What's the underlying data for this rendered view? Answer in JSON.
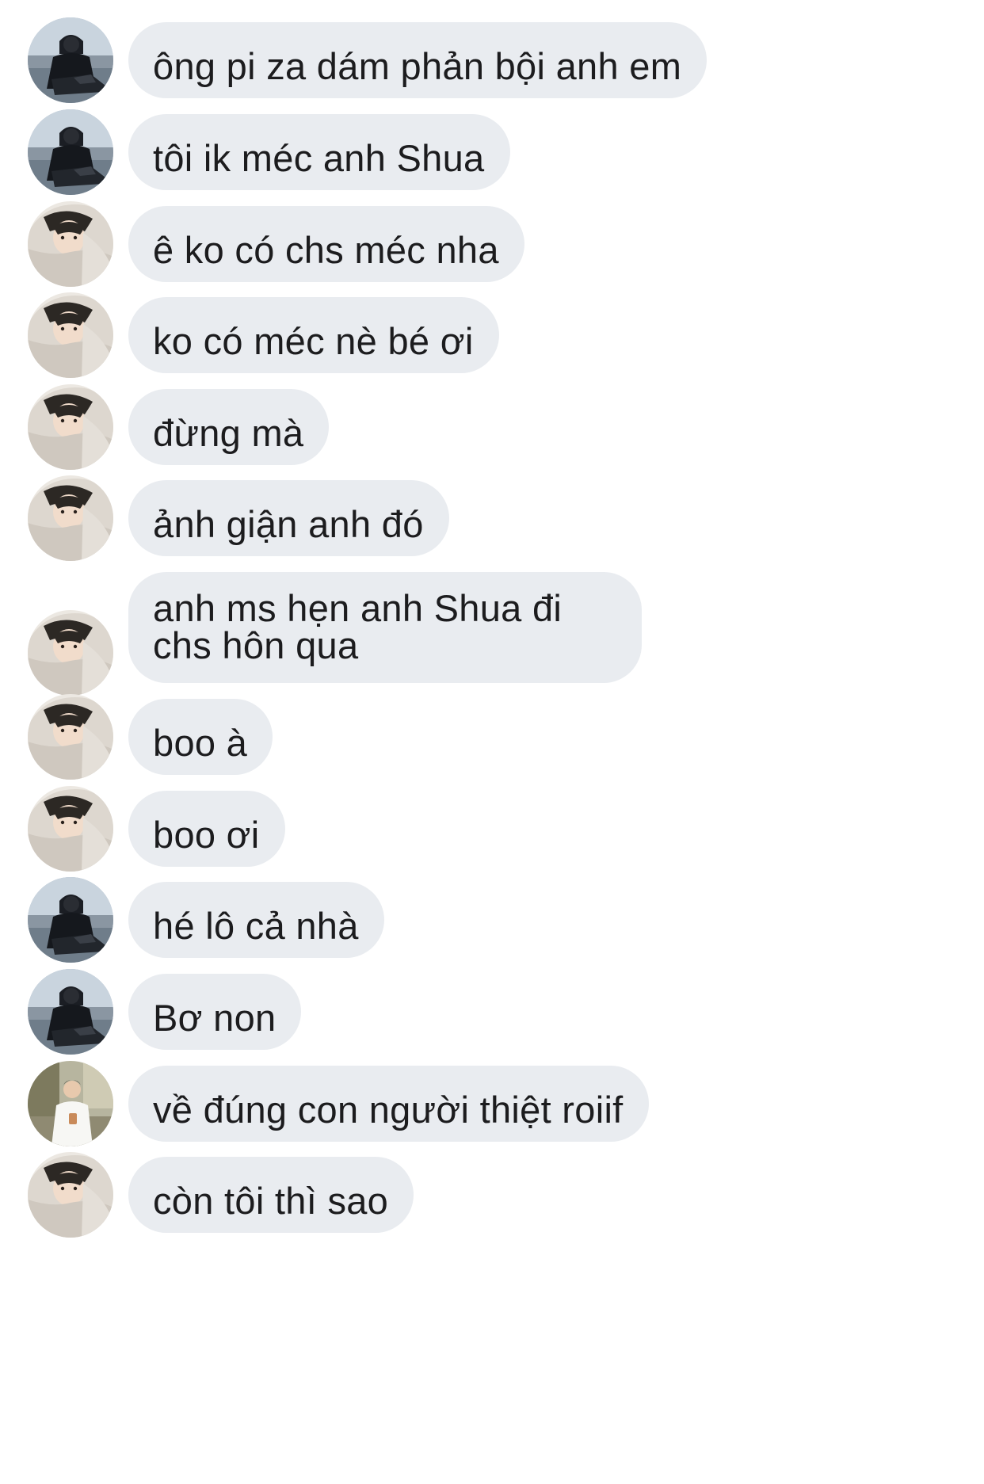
{
  "messages": [
    {
      "avatar": "dark-jacket-avatar",
      "text": "ông pi za dám phản bội anh em"
    },
    {
      "avatar": "dark-jacket-avatar",
      "text": "tôi ik méc anh Shua"
    },
    {
      "avatar": "hoodie-avatar",
      "text": "ê ko có chs méc nha"
    },
    {
      "avatar": "hoodie-avatar",
      "text": "ko có méc nè bé ơi"
    },
    {
      "avatar": "hoodie-avatar",
      "text": "đừng mà"
    },
    {
      "avatar": "hoodie-avatar",
      "text": "ảnh giận anh đó"
    },
    {
      "avatar": "hoodie-avatar",
      "text": "anh ms hẹn anh Shua đi chs hôn qua"
    },
    {
      "avatar": "hoodie-avatar",
      "text": "boo à"
    },
    {
      "avatar": "hoodie-avatar",
      "text": "boo ơi"
    },
    {
      "avatar": "dark-jacket-avatar",
      "text": "hé lô cả nhà"
    },
    {
      "avatar": "dark-jacket-avatar",
      "text": "Bơ non"
    },
    {
      "avatar": "white-shirt-avatar",
      "text": "về đúng con người thiệt roiif"
    },
    {
      "avatar": "hoodie-avatar",
      "text": "còn tôi thì sao"
    }
  ],
  "colors": {
    "bubble": "#e9ecf0",
    "text": "#1c1c1e",
    "background": "#ffffff"
  }
}
